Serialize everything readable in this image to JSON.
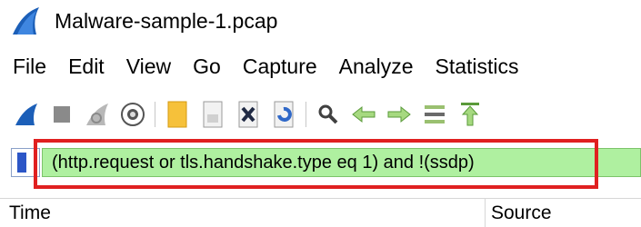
{
  "window": {
    "title": "Malware-sample-1.pcap"
  },
  "menu": [
    "File",
    "Edit",
    "View",
    "Go",
    "Capture",
    "Analyze",
    "Statistics"
  ],
  "toolbar": {
    "buttons": [
      "start-capture-icon",
      "stop-capture-icon",
      "restart-capture-icon",
      "capture-options-icon",
      "open-file-icon",
      "save-file-icon",
      "close-file-icon",
      "reload-file-icon",
      "find-packet-icon",
      "go-back-icon",
      "go-forward-icon",
      "go-to-packet-icon",
      "go-to-first-packet-icon"
    ]
  },
  "filter": {
    "value": "(http.request or tls.handshake.type eq 1) and !(ssdp)",
    "background_color": "#aff0a0",
    "highlight_color": "#e02020"
  },
  "columns": {
    "time": "Time",
    "source": "Source"
  }
}
